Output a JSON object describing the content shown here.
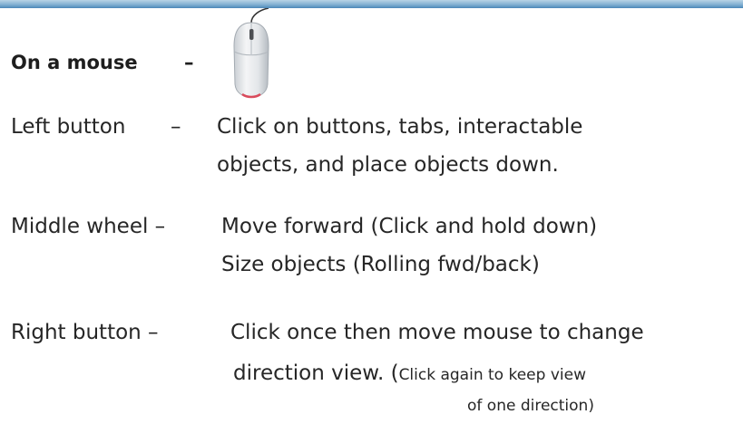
{
  "colors": {
    "top_bar": "#4a86b7",
    "text": "#262626",
    "mouse_accent": "#d94b5c"
  },
  "heading": {
    "label": "On a mouse",
    "dash": "–"
  },
  "mouse_image": {
    "icon": "computer-mouse-icon"
  },
  "rows": {
    "left": {
      "label": "Left button",
      "dash": "–",
      "line1": "Click on buttons, tabs, interactable",
      "line2": "objects, and place objects down."
    },
    "middle": {
      "label": "Middle wheel –",
      "line1": "Move forward (Click and hold down)",
      "line2": "Size objects  (Rolling fwd/back)"
    },
    "right": {
      "label": "Right button –",
      "line1": "Click once then move mouse to change",
      "line2_main": "direction view. (",
      "line2_small": "Click again to keep view",
      "line3": "of one direction)"
    }
  }
}
